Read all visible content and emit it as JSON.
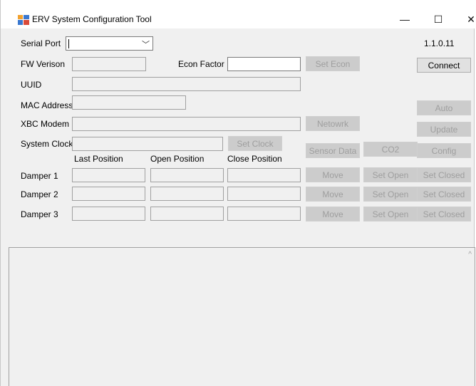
{
  "window": {
    "title": "ERV System Configuration Tool",
    "minimize": "—",
    "maximize": "☐",
    "close": "✕"
  },
  "version": "1.1.0.11",
  "labels": {
    "serial_port": "Serial Port",
    "fw_version": "FW Verison",
    "econ_factor": "Econ Factor",
    "uuid": "UUID",
    "mac_address": "MAC Address",
    "xbc_modem": "XBC Modem",
    "system_clock": "System Clock",
    "last_position": "Last Position",
    "open_position": "Open Position",
    "close_position": "Close Position",
    "damper1": "Damper 1",
    "damper2": "Damper 2",
    "damper3": "Damper 3"
  },
  "serial_port": {
    "value": ""
  },
  "buttons": {
    "set_econ": "Set Econ",
    "connect": "Connect",
    "auto": "Auto",
    "update": "Update",
    "network": "Netowrk",
    "set_clock": "Set Clock",
    "sensor_data": "Sensor Data",
    "co2": "CO2",
    "config": "Config",
    "move": "Move",
    "set_open": "Set Open",
    "set_closed": "Set Closed"
  },
  "log": {
    "scroll_up": "^"
  }
}
